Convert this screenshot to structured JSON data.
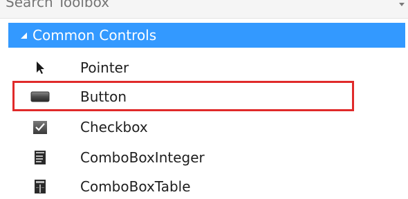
{
  "search": {
    "placeholder": "Search Toolbox"
  },
  "category": {
    "label": "Common Controls",
    "expanded": true
  },
  "items": [
    {
      "label": "Pointer",
      "icon": "pointer-icon"
    },
    {
      "label": "Button",
      "icon": "button-icon"
    },
    {
      "label": "Checkbox",
      "icon": "checkbox-icon"
    },
    {
      "label": "ComboBoxInteger",
      "icon": "combobox-integer-icon"
    },
    {
      "label": "ComboBoxTable",
      "icon": "combobox-table-icon"
    }
  ],
  "colors": {
    "header_bg": "#3399ff",
    "highlight": "#e02a2a"
  }
}
